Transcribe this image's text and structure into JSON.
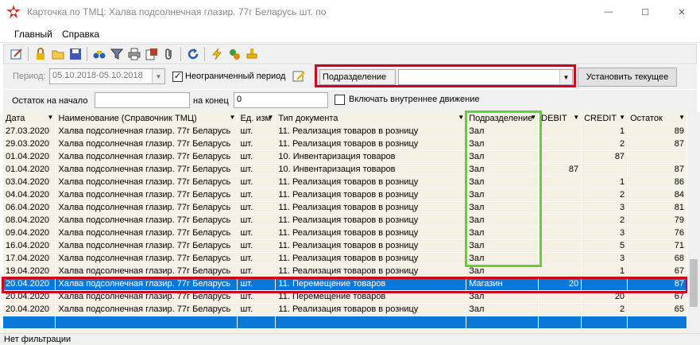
{
  "window": {
    "title": "Карточка по ТМЦ: Халва подсолнечная глазир. 77г Беларусь шт. по",
    "controls": {
      "minimize": "—",
      "maximize": "☐",
      "close": "✕"
    }
  },
  "menu": {
    "items": [
      "Главный",
      "Справка"
    ]
  },
  "toolbar": {
    "icons": [
      "edit-icon",
      "lock-icon",
      "open-folder-icon",
      "save-icon",
      "binoculars-icon",
      "filter-icon",
      "print-icon",
      "report-icon",
      "attach-icon",
      "refresh-icon",
      "lightning-icon",
      "plugin-icon",
      "stamp-icon"
    ]
  },
  "filter": {
    "period_label": "Период:",
    "period_value": "05.10.2018-05.10.2018",
    "unlimited_label": "Неограниченный период",
    "unlimited_checked": true,
    "division_label": "Подразделение",
    "division_value": "",
    "set_current_label": "Установить текущее"
  },
  "balance": {
    "start_label": "Остаток на начало",
    "start_value": "",
    "end_label": "на конец",
    "end_value": "0",
    "internal_label": "Включать внутреннее движение",
    "internal_checked": false
  },
  "grid": {
    "columns": [
      "Дата",
      "Наименование (Справочник ТМЦ)",
      "Ед. изм",
      "Тип документа",
      "Подразделение",
      "DEBIT",
      "CREDIT",
      "Остаток"
    ],
    "rows": [
      [
        "27.03.2020",
        "Халва подсолнечная глазир. 77г Беларусь",
        "шт.",
        "11. Реализация товаров в розницу",
        "Зал",
        "",
        "1",
        "89"
      ],
      [
        "29.03.2020",
        "Халва подсолнечная глазир. 77г Беларусь",
        "шт.",
        "11. Реализация товаров в розницу",
        "Зал",
        "",
        "2",
        "87"
      ],
      [
        "01.04.2020",
        "Халва подсолнечная глазир. 77г Беларусь",
        "шт.",
        "10. Инвентаризация товаров",
        "Зал",
        "",
        "87",
        ""
      ],
      [
        "01.04.2020",
        "Халва подсолнечная глазир. 77г Беларусь",
        "шт.",
        "10. Инвентаризация товаров",
        "Зал",
        "87",
        "",
        "87"
      ],
      [
        "03.04.2020",
        "Халва подсолнечная глазир. 77г Беларусь",
        "шт.",
        "11. Реализация товаров в розницу",
        "Зал",
        "",
        "1",
        "86"
      ],
      [
        "04.04.2020",
        "Халва подсолнечная глазир. 77г Беларусь",
        "шт.",
        "11. Реализация товаров в розницу",
        "Зал",
        "",
        "2",
        "84"
      ],
      [
        "06.04.2020",
        "Халва подсолнечная глазир. 77г Беларусь",
        "шт.",
        "11. Реализация товаров в розницу",
        "Зал",
        "",
        "3",
        "81"
      ],
      [
        "08.04.2020",
        "Халва подсолнечная глазир. 77г Беларусь",
        "шт.",
        "11. Реализация товаров в розницу",
        "Зал",
        "",
        "2",
        "79"
      ],
      [
        "09.04.2020",
        "Халва подсолнечная глазир. 77г Беларусь",
        "шт.",
        "11. Реализация товаров в розницу",
        "Зал",
        "",
        "3",
        "76"
      ],
      [
        "16.04.2020",
        "Халва подсолнечная глазир. 77г Беларусь",
        "шт.",
        "11. Реализация товаров в розницу",
        "Зал",
        "",
        "5",
        "71"
      ],
      [
        "17.04.2020",
        "Халва подсолнечная глазир. 77г Беларусь",
        "шт.",
        "11. Реализация товаров в розницу",
        "Зал",
        "",
        "3",
        "68"
      ],
      [
        "19.04.2020",
        "Халва подсолнечная глазир. 77г Беларусь",
        "шт.",
        "11. Реализация товаров в розницу",
        "Зал",
        "",
        "1",
        "67"
      ],
      [
        "20.04.2020",
        "Халва подсолнечная глазир. 77г Беларусь",
        "шт.",
        "11. Перемещение товаров",
        "Магазин",
        "20",
        "",
        "87"
      ],
      [
        "20.04.2020",
        "Халва подсолнечная глазир. 77г Беларусь",
        "шт.",
        "11. Перемещение товаров",
        "Зал",
        "",
        "20",
        "67"
      ],
      [
        "20.04.2020",
        "Халва подсолнечная глазир. 77г Беларусь",
        "шт.",
        "11. Реализация товаров в розницу",
        "Зал",
        "",
        "2",
        "65"
      ]
    ],
    "selected_row": 12
  },
  "status": {
    "text": "Нет фильтрации"
  },
  "colors": {
    "highlight_red": "#d0021b",
    "highlight_green": "#5dd42a",
    "selection": "#0a78d7",
    "grid_bg": "#f4f0e4"
  }
}
